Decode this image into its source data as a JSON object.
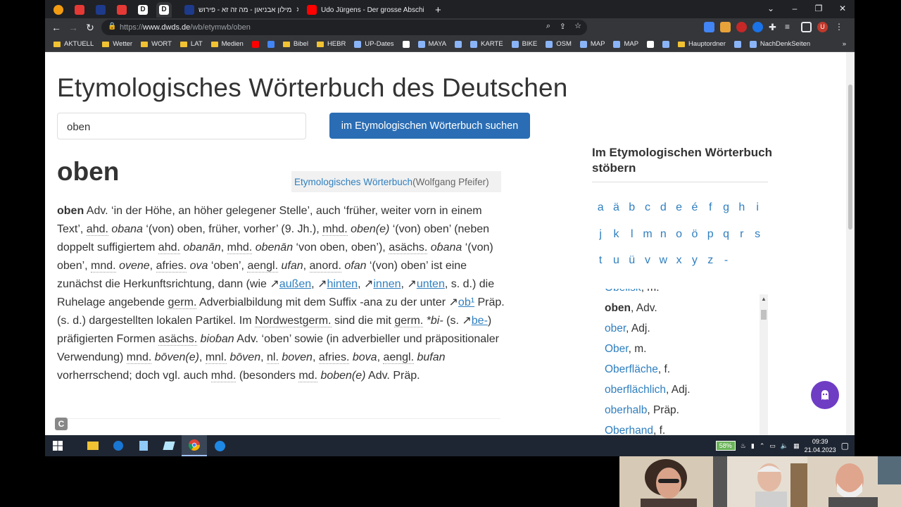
{
  "browser": {
    "tabs": [
      {
        "label": "",
        "color": "#f39c12"
      },
      {
        "label": "",
        "color": "#e53935"
      },
      {
        "label": "",
        "color": "#1e3a8a"
      },
      {
        "label": "",
        "color": "#e53935"
      },
      {
        "label": "D",
        "color": "#ffffff"
      },
      {
        "label": "D",
        "color": "#ffffff"
      },
      {
        "label": "מילון אבניאון - מה זה זא - פירוש",
        "color": "#1e3a8a"
      },
      {
        "label": "Udo Jürgens - Der grosse Abschi",
        "color": "#ff0000"
      }
    ],
    "new_tab": "+",
    "url_prefix": "https://",
    "url_host": "www.dwds.de",
    "url_path": "/wb/etymwb/oben",
    "bookmarks": [
      {
        "label": "AKTUELL",
        "type": "folder"
      },
      {
        "label": "Wetter",
        "type": "folder"
      },
      {
        "label": "WORT",
        "type": "folder"
      },
      {
        "label": "LAT",
        "type": "folder"
      },
      {
        "label": "Medien",
        "type": "folder"
      },
      {
        "label": "",
        "type": "youtube"
      },
      {
        "label": "",
        "type": "google"
      },
      {
        "label": "Bibel",
        "type": "folder"
      },
      {
        "label": "HEBR",
        "type": "folder"
      },
      {
        "label": "UP-Dates",
        "type": "site"
      },
      {
        "label": "",
        "type": "wiki"
      },
      {
        "label": "MAYA",
        "type": "site"
      },
      {
        "label": "",
        "type": "site"
      },
      {
        "label": "KARTE",
        "type": "site"
      },
      {
        "label": "BIKE",
        "type": "site"
      },
      {
        "label": "OSM",
        "type": "site"
      },
      {
        "label": "MAP",
        "type": "site"
      },
      {
        "label": "MAP",
        "type": "site"
      },
      {
        "label": "",
        "type": "amazon"
      },
      {
        "label": "",
        "type": "site"
      },
      {
        "label": "Hauptordner",
        "type": "folder"
      },
      {
        "label": "",
        "type": "site"
      },
      {
        "label": "NachDenkSeiten",
        "type": "site"
      }
    ],
    "bookmarks_more": "»",
    "profile_initial": "U"
  },
  "page": {
    "title": "Etymologisches Wörterbuch des Deutschen",
    "search_value": "oben",
    "search_button": "im Etymologischen Wörterbuch suchen",
    "headword": "oben",
    "source_link": "Etymologisches Wörterbuch",
    "source_author": " (Wolfgang Pfeifer)",
    "entry": {
      "p1": "oben",
      "p2": " Adv. ‘in der Höhe, an höher gelegener Stelle’, auch ‘früher, weiter vorn in einem Text’, ",
      "ab_ahd1": "ahd.",
      "i_obana": "obana",
      "p3": " ‘(von) oben, früher, vorher’ (9. Jh.), ",
      "ab_mhd1": "mhd.",
      "i_obene": "oben(e)",
      "p4": " ‘(von) oben’ (neben doppelt suffigiertem ",
      "ab_ahd2": "ahd.",
      "i_obanan": "obanān",
      "p5": ", ",
      "ab_mhd2": "mhd.",
      "i_obenan": "obenān",
      "p6": " ‘von oben, oben’), ",
      "ab_asachs": "asächs.",
      "i_obana2": "oɓana",
      "p7": " ‘(von) oben’, ",
      "ab_mnd": "mnd.",
      "i_ovene": "ovene",
      "p8": ", ",
      "ab_afries": "afries.",
      "i_ova": "ova",
      "p9": " ‘oben’, ",
      "ab_aengl": "aengl.",
      "i_ufan": "ufan",
      "p10": ", ",
      "ab_anord": "anord.",
      "i_ofan": "ofan",
      "p11": " ‘(von) oben’ ist eine zunächst die Herkunftsrichtung, dann (wie ",
      "ref_aussen": "außen",
      "p12": ", ",
      "ref_hinten": "hinten",
      "p13": ", ",
      "ref_innen": "innen",
      "p14": ", ",
      "ref_unten": "unten",
      "p15": ", s. d.) die Ruhelage angebende ",
      "ab_germ1": "germ.",
      "p16": " Adverbialbildung mit dem Suffix -ana zu der unter ",
      "ref_ob": "ob¹",
      "p17": " Präp. (s. d.) dargestellten lokalen Partikel. Im ",
      "ab_nwgerm": "Nordwestgerm.",
      "p18": " sind die mit ",
      "ab_germ2": "germ.",
      "i_bi": "*bi-",
      "p19": " (s. ",
      "ref_be": "be-",
      "p20": ") präfigierten Formen ",
      "ab_asachs2": "asächs.",
      "i_biobana": "bioɓan",
      "p21": " Adv. ‘oben’ sowie (in adverbieller und präpositionaler Verwendung) ",
      "ab_mnd2": "mnd.",
      "i_boven": "bōven(e)",
      "p22": ", ",
      "ab_mnl": "mnl.",
      "i_boven2": "bōven",
      "p23": ", ",
      "ab_nl": "nl.",
      "i_boven3": "boven",
      "p24": ", ",
      "ab_afries2": "afries.",
      "i_bova": "bova",
      "p25": ", ",
      "ab_aengl2": "aengl.",
      "i_bufan": "bufan",
      "p26": " vorherrschend; doch vgl. auch ",
      "ab_mhd3": "mhd.",
      "p27": " (besonders ",
      "ab_md": "md.",
      "i_bobene": "boben(e)",
      "p28": " Adv. Präp."
    },
    "sidebar": {
      "title": "Im Etymologischen Wörterbuch stöbern",
      "letters": [
        "a",
        "ä",
        "b",
        "c",
        "d",
        "e",
        "é",
        "f",
        "g",
        "h",
        "i",
        "j",
        "k",
        "l",
        "m",
        "n",
        "o",
        "ö",
        "p",
        "q",
        "r",
        "s",
        "t",
        "u",
        "ü",
        "v",
        "w",
        "x",
        "y",
        "z",
        "-"
      ],
      "lemmas": [
        {
          "word": "Obelisk",
          "pos": ", m.",
          "current": false
        },
        {
          "word": "oben",
          "pos": ", Adv.",
          "current": true
        },
        {
          "word": "ober",
          "pos": ", Adj.",
          "current": false
        },
        {
          "word": "Ober",
          "pos": ", m.",
          "current": false
        },
        {
          "word": "Oberfläche",
          "pos": ", f.",
          "current": false
        },
        {
          "word": "oberflächlich",
          "pos": ", Adj.",
          "current": false
        },
        {
          "word": "oberhalb",
          "pos": ", Präp.",
          "current": false
        },
        {
          "word": "Oberhand",
          "pos": ", f.",
          "current": false
        }
      ]
    },
    "license_badge": "C"
  },
  "taskbar": {
    "battery": "58%",
    "time": "09:39",
    "date": "21.04.2023"
  }
}
